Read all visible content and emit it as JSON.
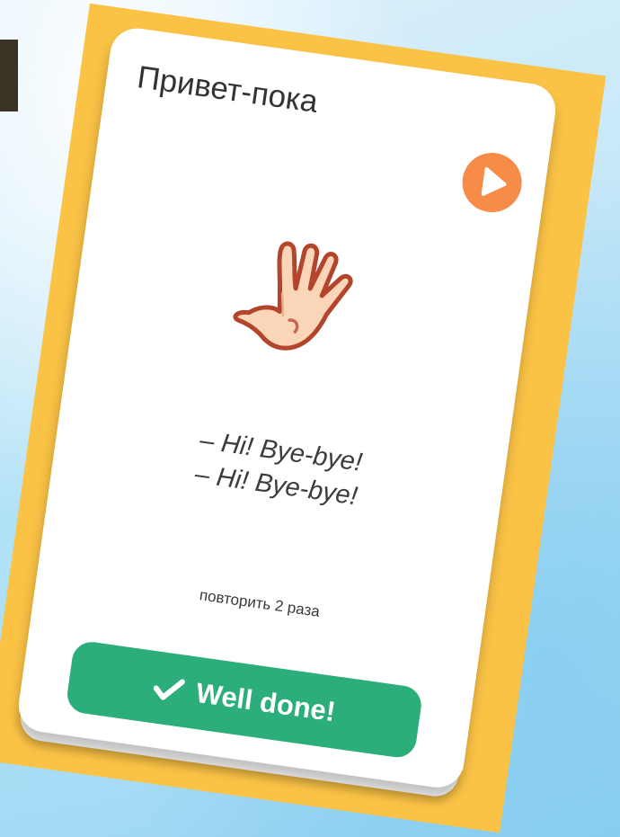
{
  "card": {
    "title": "Привет-пока",
    "phrase_line_1": "– Hi! Bye-bye!",
    "phrase_line_2": "– Hi! Bye-bye!",
    "repeat_note": "повторить 2 раза"
  },
  "actions": {
    "play_icon": "play-icon",
    "done_label": "Well done!",
    "done_icon": "checkmark-icon"
  },
  "illustration": {
    "icon": "hand-icon"
  },
  "colors": {
    "frame": "#fbc346",
    "card": "#ffffff",
    "play_button": "#f78b48",
    "done_button": "#2cae7a",
    "text": "#333333"
  }
}
